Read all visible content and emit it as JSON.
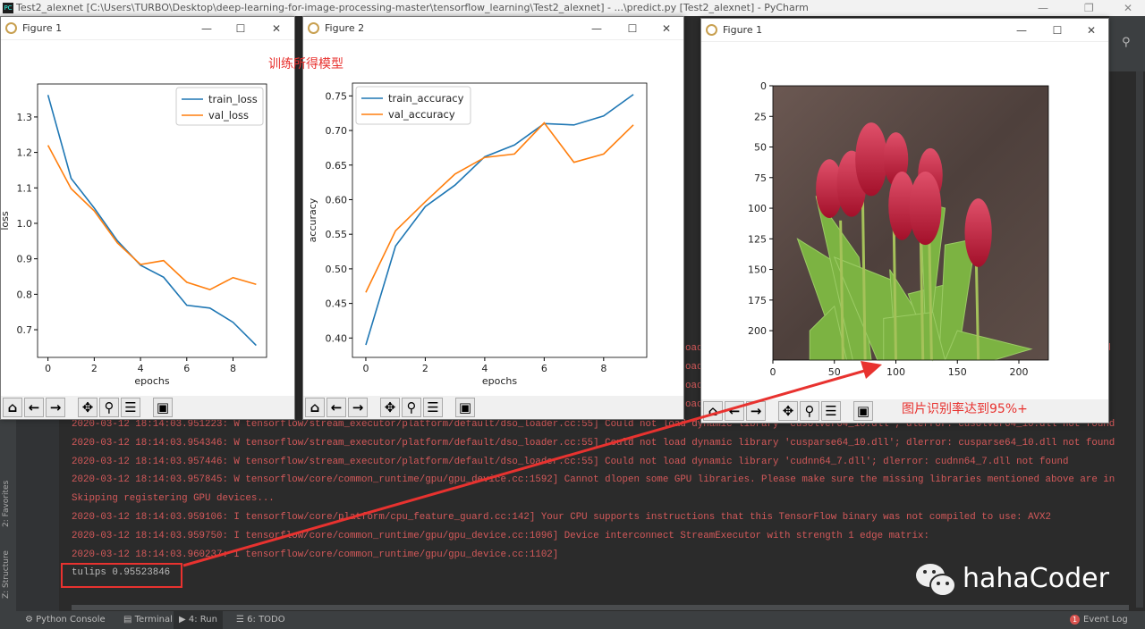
{
  "app": {
    "title": "Test2_alexnet [C:\\Users\\TURBO\\Desktop\\deep-learning-for-image-processing-master\\tensorflow_learning\\Test2_alexnet] - ...\\predict.py [Test2_alexnet] - PyCharm",
    "logo": "PC"
  },
  "left_strip": {
    "favorites": "2: Favorites",
    "structure": "Z: Structure"
  },
  "windows": {
    "fig_loss": {
      "title": "Figure 1"
    },
    "fig_acc": {
      "title": "Figure 2"
    },
    "fig_img": {
      "title": "Figure 1"
    }
  },
  "toolbar_icons": [
    "home-icon",
    "back-icon",
    "forward-icon",
    "pan-icon",
    "zoom-icon",
    "configure-icon",
    "save-icon"
  ],
  "console": {
    "fragments": [
      "ound",
      "nd",
      "oad",
      "oad",
      "oad",
      "oad",
      "nd"
    ],
    "lines": [
      "2020-03-12 18:14:03.951223: W tensorflow/stream_executor/platform/default/dso_loader.cc:55] Could not load dynamic library 'cusolver64_10.dll'; dlerror: cusolver64_10.dll not found",
      "2020-03-12 18:14:03.954346: W tensorflow/stream_executor/platform/default/dso_loader.cc:55] Could not load dynamic library 'cusparse64_10.dll'; dlerror: cusparse64_10.dll not found",
      "2020-03-12 18:14:03.957446: W tensorflow/stream_executor/platform/default/dso_loader.cc:55] Could not load dynamic library 'cudnn64_7.dll'; dlerror: cudnn64_7.dll not found",
      "2020-03-12 18:14:03.957845: W tensorflow/core/common_runtime/gpu/gpu_device.cc:1592] Cannot dlopen some GPU libraries. Please make sure the missing libraries mentioned above are in",
      "Skipping registering GPU devices...",
      "2020-03-12 18:14:03.959106: I tensorflow/core/platform/cpu_feature_guard.cc:142] Your CPU supports instructions that this TensorFlow binary was not compiled to use: AVX2",
      "2020-03-12 18:14:03.959750: I tensorflow/core/common_runtime/gpu/gpu_device.cc:1096] Device interconnect StreamExecutor with strength 1 edge matrix:",
      "2020-03-12 18:14:03.960237: I tensorflow/core/common_runtime/gpu/gpu_device.cc:1102]"
    ],
    "result": "tulips 0.95523846"
  },
  "annotations": {
    "model_label": "训练所得模型",
    "accuracy_label": "图片识别率达到95%+",
    "color": "#e8322f"
  },
  "watermark": {
    "text": "hahaCoder",
    "icon": "wechat-icon"
  },
  "statusbar": {
    "python_console": "Python Console",
    "terminal": "Terminal",
    "run": "4: Run",
    "todo": "6: TODO",
    "event_log": "Event Log",
    "event_count": "1"
  },
  "chart_data": [
    {
      "type": "line",
      "xlabel": "epochs",
      "ylabel": "loss",
      "x": [
        0,
        1,
        2,
        3,
        4,
        5,
        6,
        7,
        8,
        9
      ],
      "xlim": [
        -0.45,
        9.45
      ],
      "ylim": [
        0.622,
        1.393
      ],
      "xticks": [
        0,
        2,
        4,
        6,
        8
      ],
      "yticks": [
        0.7,
        0.8,
        0.9,
        1.0,
        1.1,
        1.2,
        1.3
      ],
      "legend": "top-right",
      "grid": false,
      "series": [
        {
          "name": "train_loss",
          "color": "#1f77b4",
          "values": [
            1.362,
            1.127,
            1.043,
            0.951,
            0.882,
            0.848,
            0.769,
            0.761,
            0.721,
            0.656
          ]
        },
        {
          "name": "val_loss",
          "color": "#ff7f0e",
          "values": [
            1.22,
            1.098,
            1.035,
            0.945,
            0.884,
            0.895,
            0.834,
            0.813,
            0.847,
            0.828
          ]
        }
      ]
    },
    {
      "type": "line",
      "xlabel": "epochs",
      "ylabel": "accuracy",
      "x": [
        0,
        1,
        2,
        3,
        4,
        5,
        6,
        7,
        8,
        9
      ],
      "xlim": [
        -0.45,
        9.45
      ],
      "ylim": [
        0.372,
        0.7685
      ],
      "xticks": [
        0,
        2,
        4,
        6,
        8
      ],
      "yticks": [
        0.4,
        0.45,
        0.5,
        0.55,
        0.6,
        0.65,
        0.7,
        0.75
      ],
      "legend": "top-left",
      "grid": false,
      "series": [
        {
          "name": "train_accuracy",
          "color": "#1f77b4",
          "values": [
            0.39,
            0.533,
            0.59,
            0.621,
            0.662,
            0.679,
            0.71,
            0.708,
            0.721,
            0.752
          ]
        },
        {
          "name": "val_accuracy",
          "color": "#ff7f0e",
          "values": [
            0.466,
            0.555,
            0.597,
            0.637,
            0.661,
            0.666,
            0.711,
            0.654,
            0.666,
            0.708
          ]
        }
      ]
    },
    {
      "type": "image",
      "xlim": [
        0,
        224
      ],
      "ylim": [
        224,
        0
      ],
      "xticks": [
        0,
        50,
        100,
        150,
        200
      ],
      "yticks": [
        0,
        25,
        50,
        75,
        100,
        125,
        150,
        175,
        200
      ]
    }
  ]
}
